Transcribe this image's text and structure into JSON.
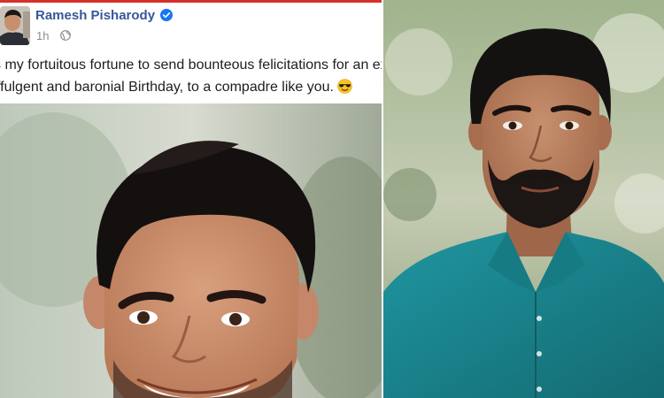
{
  "post": {
    "author_name": "Ramesh Pisharody",
    "time": "1h",
    "text_line_1": "s my fortuitous fortune to send bounteous felicitations for an exult",
    "text_line_2": "ffulgent and baronial Birthday, to a compadre like you."
  },
  "icons": {
    "verified": "verified-badge-icon",
    "privacy": "globe-icon",
    "emoji": "sunglasses-emoji-icon"
  },
  "colors": {
    "author_link": "#365899",
    "verified_badge": "#1877f2",
    "top_bar": "#d8312a",
    "shirt": "#1d8a93"
  }
}
